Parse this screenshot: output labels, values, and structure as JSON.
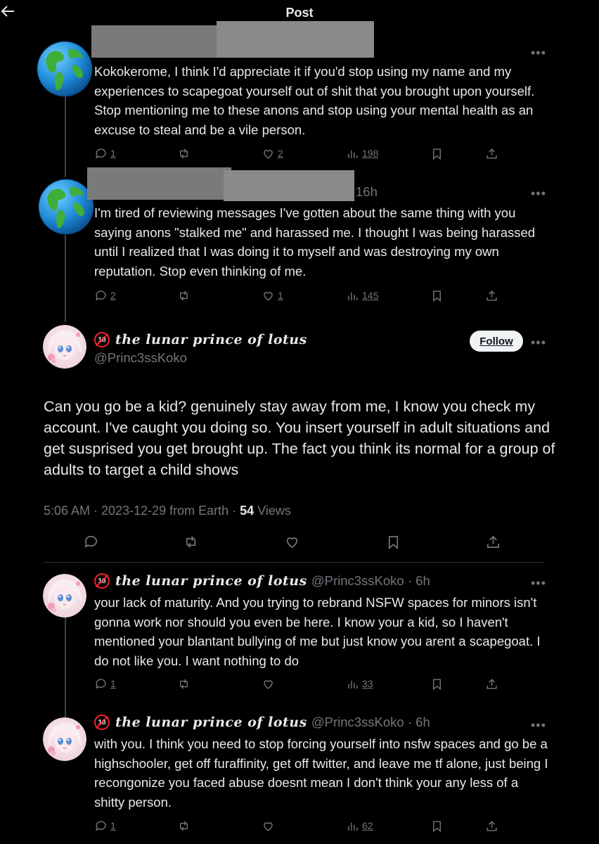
{
  "header": {
    "title": "Post",
    "back_icon": "arrow-left-icon"
  },
  "colors": {
    "background": "#000000",
    "text": "#e7e9ea",
    "muted": "#71767b",
    "badge_red": "#f4212e"
  },
  "replies_above": [
    {
      "avatar_icon": "globe-emoji",
      "time": "",
      "text": "Kokokerome, I think I'd appreciate it if you'd stop using my name and my experiences to scapegoat yourself out of shit that you brought upon yourself. Stop mentioning me to these anons and stop using your mental health as an excuse to steal and be a vile person.",
      "replies": "1",
      "likes": "2",
      "views": "198"
    },
    {
      "avatar_icon": "globe-emoji",
      "time": "16h",
      "text": "I'm tired of reviewing messages I've gotten about the same thing with you saying anons \"stalked me\" and harassed me. I thought I was being harassed until I realized that I was doing it to myself and was destroying my own reputation. Stop even thinking of me.",
      "replies": "2",
      "likes": "1",
      "views": "145"
    }
  ],
  "main_post": {
    "badge": "18",
    "display_name": "the lunar prince of lotus",
    "handle": "@Princ3ssKoko",
    "follow_label": "Follow",
    "text": "Can you go be a kid? genuinely stay away from me, I know you check my account. I've caught you doing so. You insert yourself in adult situations and get susprised you get brought up. The fact you think its normal for a group of adults to target a child shows",
    "timestamp": "5:06 AM · 2023-12-29 from Earth · ",
    "views_count": "54",
    "views_label": " Views"
  },
  "replies_below": [
    {
      "badge": "18",
      "display_name": "the lunar prince of lotus",
      "handle_time": "@Princ3ssKoko · 6h",
      "text": "your lack of maturity. And you trying to rebrand NSFW spaces for minors isn't gonna work nor should you even be here. I know your a kid, so I haven't mentioned your blantant bullying of me but just know you arent a scapegoat. I do not like you. I want nothing to do",
      "replies": "1",
      "likes": "",
      "views": "33"
    },
    {
      "badge": "18",
      "display_name": "the lunar prince of lotus",
      "handle_time": "@Princ3ssKoko · 6h",
      "text": "with you. I think you need to stop forcing yourself into nsfw spaces and go be a highschooler, get off furaffinity, get off twitter, and leave me tf alone, just being I recongonize you faced abuse doesnt mean I don't think your any less of a shitty person.",
      "replies": "1",
      "likes": "",
      "views": "62"
    }
  ]
}
